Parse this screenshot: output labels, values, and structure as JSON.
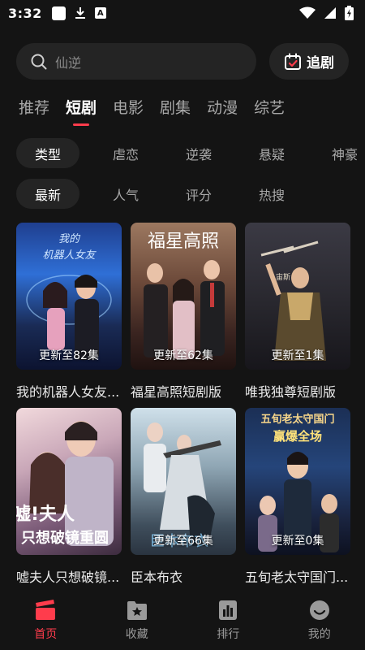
{
  "status": {
    "time": "3:32"
  },
  "search": {
    "placeholder": "仙逆"
  },
  "follow_button": {
    "label": "追剧"
  },
  "tabs": [
    {
      "label": "推荐",
      "active": false
    },
    {
      "label": "短剧",
      "active": true
    },
    {
      "label": "电影",
      "active": false
    },
    {
      "label": "剧集",
      "active": false
    },
    {
      "label": "动漫",
      "active": false
    },
    {
      "label": "综艺",
      "active": false
    }
  ],
  "filters": {
    "row1": [
      "类型",
      "虐恋",
      "逆袭",
      "悬疑",
      "神豪"
    ],
    "row2": [
      "最新",
      "人气",
      "评分",
      "热搜"
    ]
  },
  "cards": [
    {
      "title": "我的机器人女友...",
      "caption": "更新至82集",
      "poster_text": "我的机器人女友"
    },
    {
      "title": "福星高照短剧版",
      "caption": "更新至62集",
      "poster_text": "福星高照"
    },
    {
      "title": "唯我独尊短剧版",
      "caption": "更新至1集",
      "poster_text": "宙斯"
    },
    {
      "title": "嘘夫人只想破镜...",
      "caption": "",
      "poster_text": "嘘!夫人 只想破镜重圆"
    },
    {
      "title": "臣本布衣",
      "caption": "更新至66集",
      "poster_text": "臣本布衣"
    },
    {
      "title": "五旬老太守国门...",
      "caption": "更新至0集",
      "poster_text": "五旬老太守国门 赢爆全场"
    }
  ],
  "bottom_nav": [
    {
      "label": "首页",
      "icon": "clapperboard-icon",
      "active": true
    },
    {
      "label": "收藏",
      "icon": "folder-star-icon",
      "active": false
    },
    {
      "label": "排行",
      "icon": "bar-chart-icon",
      "active": false
    },
    {
      "label": "我的",
      "icon": "profile-icon",
      "active": false
    }
  ],
  "colors": {
    "accent": "#ff3c4c",
    "background": "#141414",
    "surface": "#242424"
  }
}
